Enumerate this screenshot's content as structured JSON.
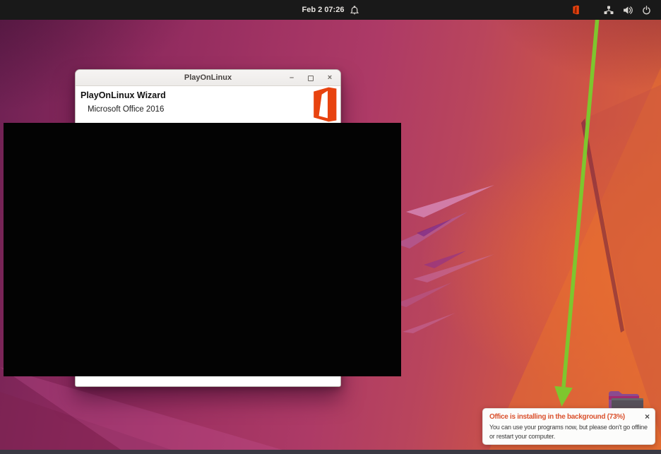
{
  "topbar": {
    "clock": "Feb 2 07:26"
  },
  "window": {
    "title": "PlayOnLinux",
    "wizard_heading": "PlayOnLinux Wizard",
    "wizard_subheading": "Microsoft Office 2016",
    "controls": {
      "minimize": "–",
      "close": "×"
    }
  },
  "notification": {
    "title": "Office is installing in the background (73%)",
    "body": "You can use your programs now, but please don't go offline or restart your computer.",
    "progress_percent": 73,
    "close": "×"
  },
  "icons": {
    "bell": "notification-bell-icon",
    "office_indicator": "office-indicator-icon",
    "network": "network-icon",
    "volume": "volume-icon",
    "power": "power-icon",
    "folder": "folder-icon",
    "office_logo": "office-logo"
  },
  "colors": {
    "office_orange": "#e8430f",
    "arrow_green": "#7ec62e",
    "notification_title": "#da512d",
    "topbar_bg": "#191919"
  }
}
